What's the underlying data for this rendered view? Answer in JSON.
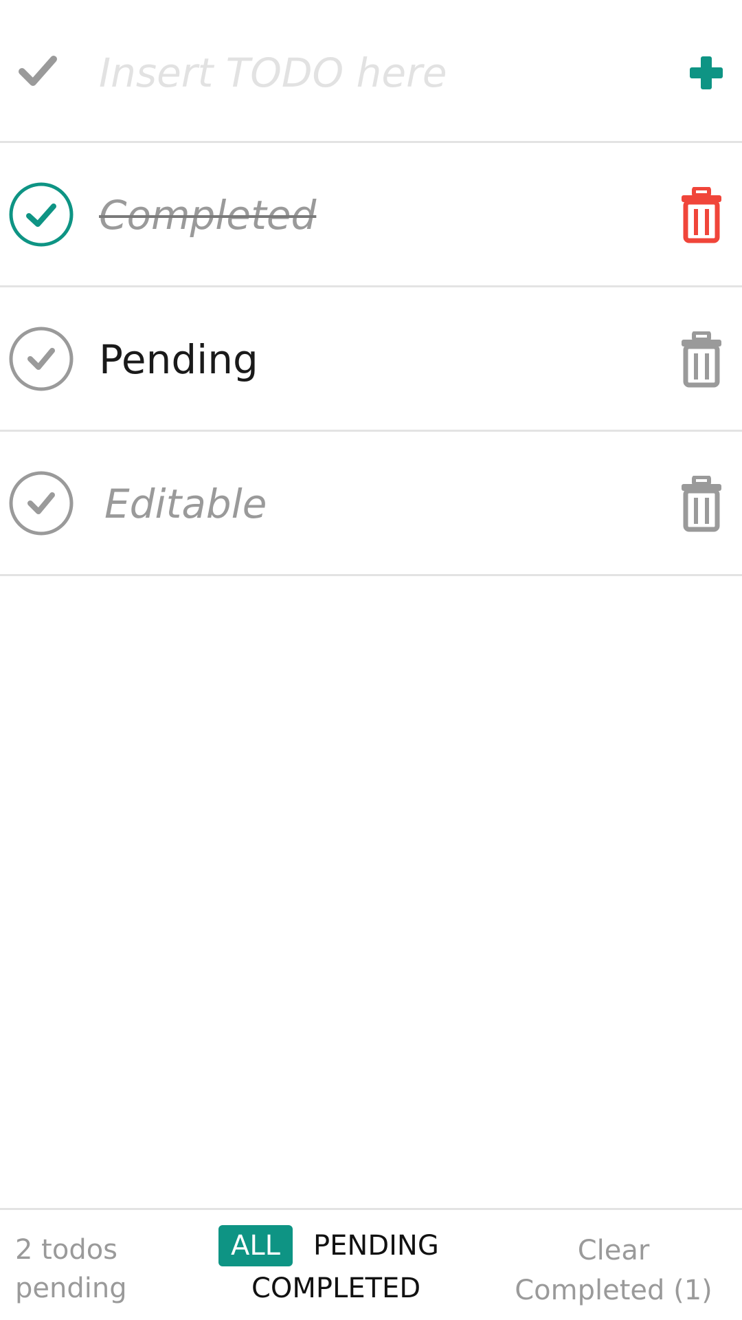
{
  "header": {
    "toggle_icon": "check-icon",
    "input_placeholder": "Insert TODO here",
    "input_value": "",
    "add_icon": "plus-icon",
    "accent_color": "#0e9484"
  },
  "todos": [
    {
      "text": "Completed",
      "state": "completed",
      "check_color": "#0e9484",
      "delete_color": "#f0453a"
    },
    {
      "text": "Pending",
      "state": "pending",
      "check_color": "#9a9a9a",
      "delete_color": "#9a9a9a"
    },
    {
      "text": "Editable",
      "state": "editing",
      "check_color": "#9a9a9a",
      "delete_color": "#9a9a9a"
    }
  ],
  "footer": {
    "count_number": "2",
    "count_label_line1": "2 todos",
    "count_label_line2": "pending",
    "filters": {
      "all": "ALL",
      "pending": "PENDING",
      "completed": "COMPLETED"
    },
    "active_filter": "ALL",
    "clear_line1": "Clear",
    "clear_line2": "Completed (1)"
  }
}
